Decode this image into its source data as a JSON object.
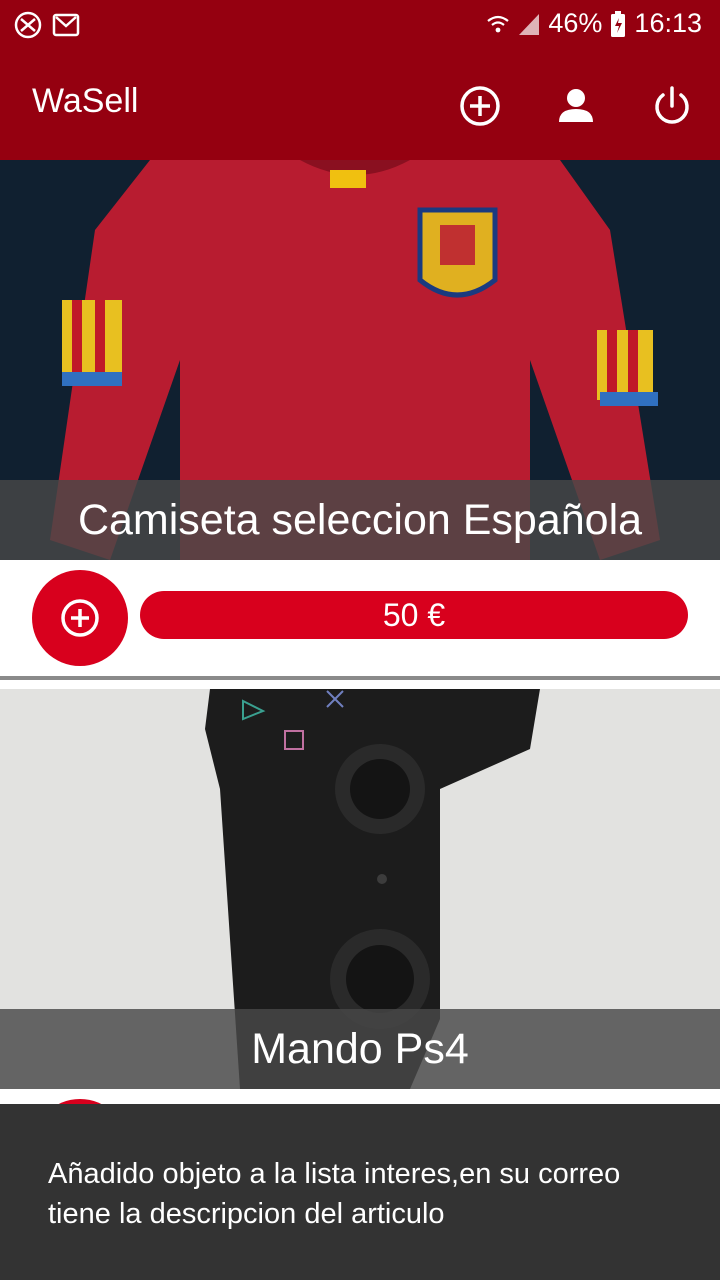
{
  "status_bar": {
    "battery": "46%",
    "time": "16:13",
    "icons": [
      "xbox-notification-icon",
      "gmail-icon",
      "wifi-icon",
      "signal-icon",
      "battery-icon"
    ]
  },
  "app_bar": {
    "title": "WaSell",
    "actions": [
      "add-circle-icon",
      "person-icon",
      "power-icon"
    ]
  },
  "items": [
    {
      "title": "Camiseta seleccion Española",
      "price": "50 €",
      "image": "spain-football-shirt"
    },
    {
      "title": "Mando Ps4",
      "price": "",
      "image": "ps4-controller"
    }
  ],
  "snackbar": {
    "message": "Añadido objeto a la lista interes,en su correo tiene la descripcion del articulo"
  },
  "colors": {
    "primary_dark": "#950010",
    "accent": "#d8001d",
    "band": "#484848",
    "snackbar": "#333333"
  }
}
